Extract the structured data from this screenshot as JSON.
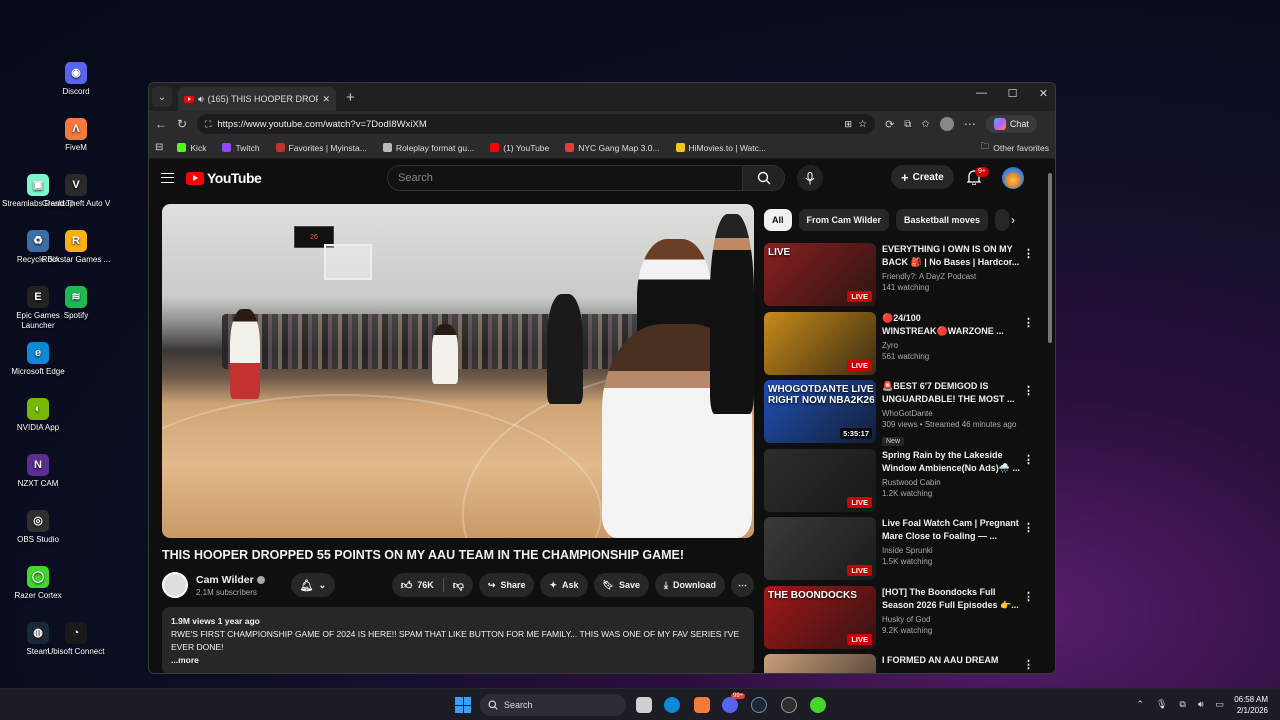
{
  "desktop": {
    "icons": [
      {
        "label": "Discord",
        "color": "#5865f2",
        "glyph": "◉"
      },
      {
        "label": "FiveM",
        "color": "#f5793a",
        "glyph": "Λ"
      },
      {
        "label": "Streamlabs Desktop",
        "color": "#80f5d2",
        "glyph": "▣"
      },
      {
        "label": "Grand Theft Auto V",
        "color": "#2a2a2a",
        "glyph": "V"
      },
      {
        "label": "Recycle Bin",
        "color": "#3a6ea5",
        "glyph": "♻"
      },
      {
        "label": "Rockstar Games ...",
        "color": "#fcaf17",
        "glyph": "R"
      },
      {
        "label": "Epic Games Launcher",
        "color": "#222222",
        "glyph": "E"
      },
      {
        "label": "Spotify",
        "color": "#1db954",
        "glyph": "≋"
      },
      {
        "label": "Microsoft Edge",
        "color": "#0c8ad8",
        "glyph": "e"
      },
      {
        "label": "NVIDIA App",
        "color": "#76b900",
        "glyph": "◐"
      },
      {
        "label": "NZXT CAM",
        "color": "#5a2d91",
        "glyph": "N"
      },
      {
        "label": "OBS Studio",
        "color": "#302e31",
        "glyph": "◎"
      },
      {
        "label": "Razer Cortex",
        "color": "#44d62c",
        "glyph": "◯"
      },
      {
        "label": "Steam",
        "color": "#1b2838",
        "glyph": "◍"
      },
      {
        "label": "Ubisoft Connect",
        "color": "#1a1a1a",
        "glyph": "◔"
      }
    ]
  },
  "browser": {
    "tab_title": "(165) THIS HOOPER DROPPED 5",
    "url": "https://www.youtube.com/watch?v=7DodI8WxiXM",
    "chat_label": "Chat",
    "favorites": [
      "Kick",
      "Twitch",
      "Favorites | Myinsta...",
      "Roleplay format gu...",
      "(1) YouTube",
      "NYC Gang Map 3.0...",
      "HiMovies.to | Watc..."
    ],
    "other_favorites": "Other favorites"
  },
  "youtube": {
    "logo": "YouTube",
    "search_placeholder": "Search",
    "create_label": "Create",
    "notif_count": "9+",
    "scoreboard": "26",
    "video_title": "THIS HOOPER DROPPED 55 POINTS ON MY AAU TEAM IN THE CHAMPIONSHIP GAME!",
    "channel_name": "Cam Wilder",
    "subscribers": "2.1M subscribers",
    "likes": "76K",
    "share_label": "Share",
    "ask_label": "Ask",
    "save_label": "Save",
    "download_label": "Download",
    "desc_stats": "1.9M views  1 year ago",
    "desc_text": "RWE'S FIRST CHAMPIONSHIP GAME OF 2024 IS HERE!! SPAM THAT LIKE BUTTON FOR ME FAMILY... THIS WAS ONE OF MY FAV SERIES I'VE EVER DONE!",
    "desc_more": "...more",
    "chips": [
      "All",
      "From Cam Wilder",
      "Basketball moves"
    ],
    "recommendations": [
      {
        "title": "EVERYTHING I OWN IS ON MY BACK 🎒 | No Bases | Hardcor...",
        "channel": "Friendly?: A DayZ Podcast",
        "meta": "141 watching",
        "badge": "LIVE",
        "thumb_text": "LIVE",
        "thumb_bg": "#8a1f1f"
      },
      {
        "title": "🔴24/100 WINSTREAK🔴WARZONE ...",
        "channel": "Zyro",
        "meta": "561 watching",
        "badge": "LIVE",
        "thumb_text": "",
        "thumb_bg": "#c98a1a"
      },
      {
        "title": "🚨BEST 6'7 DEMIGOD IS UNGUARDABLE! THE MOST ...",
        "channel": "WhoGotDante",
        "meta": "309 views • Streamed 46 minutes ago",
        "badge": "5:35:17",
        "thumb_text": "WHOGOTDANTE LIVE RIGHT NOW NBA2K26",
        "thumb_bg": "#1e4fb5",
        "is_new": "New"
      },
      {
        "title": "Spring Rain by the Lakeside Window Ambience(No Ads)🌧️ ...",
        "channel": "Rustwood Cabin",
        "meta": "1.2K watching",
        "badge": "LIVE",
        "thumb_text": "",
        "thumb_bg": "#2b2f2a"
      },
      {
        "title": "Live Foal Watch Cam | Pregnant Mare Close to Foaling — ...",
        "channel": "Inside Sprunki",
        "meta": "1.5K watching",
        "badge": "LIVE",
        "thumb_text": "",
        "thumb_bg": "#3a3a3a"
      },
      {
        "title": "[HOT] The Boondocks Full Season 2026 Full Episodes 👉...",
        "channel": "Husky of God",
        "meta": "9.2K watching",
        "badge": "LIVE",
        "thumb_text": "THE BOONDOCKS",
        "thumb_bg": "#a31818"
      },
      {
        "title": "I FORMED AN AAU DREAM",
        "channel": "",
        "meta": "",
        "badge": "",
        "thumb_text": "",
        "thumb_bg": "#c9a07a"
      }
    ]
  },
  "taskbar": {
    "search_label": "Search",
    "time": "06:58 AM",
    "date": "2/1/2026",
    "notif_badge": "99+"
  }
}
